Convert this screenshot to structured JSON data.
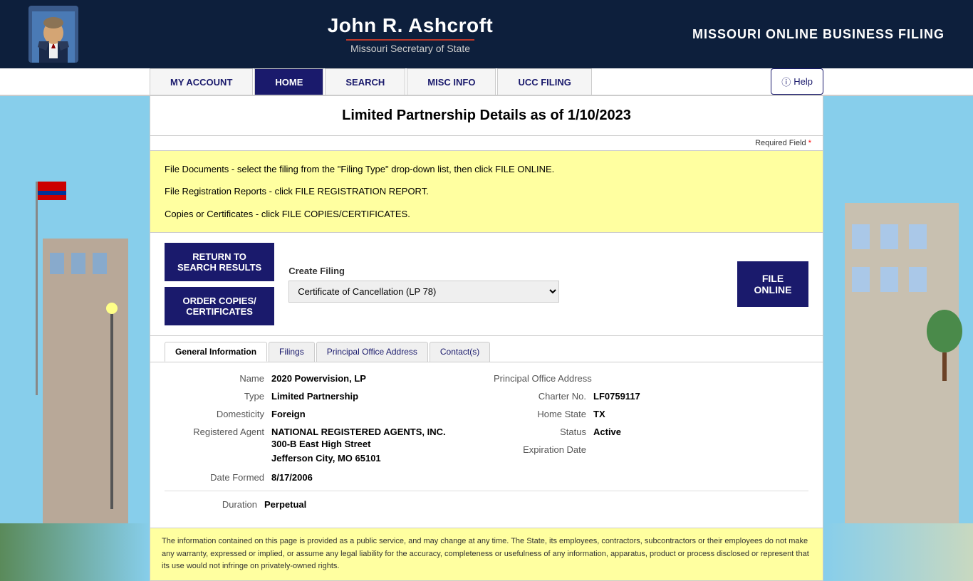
{
  "header": {
    "person_name": "John R. Ashcroft",
    "person_title": "Missouri Secretary of State",
    "site_title": "MISSOURI ONLINE BUSINESS FILING"
  },
  "nav": {
    "items": [
      {
        "label": "MY ACCOUNT",
        "active": false
      },
      {
        "label": "HOME",
        "active": true
      },
      {
        "label": "SEARCH",
        "active": false
      },
      {
        "label": "MISC INFO",
        "active": false
      },
      {
        "label": "UCC FILING",
        "active": false
      }
    ],
    "help_label": "Help"
  },
  "page": {
    "title": "Limited Partnership Details as of 1/10/2023",
    "required_field": "Required Field",
    "instructions": [
      "File Documents - select the filing from the \"Filing Type\" drop-down list, then click FILE ONLINE.",
      "File Registration Reports - click FILE REGISTRATION REPORT.",
      "Copies or Certificates - click FILE COPIES/CERTIFICATES."
    ]
  },
  "actions": {
    "return_to_search": "RETURN TO\nSEARCH RESULTS",
    "order_copies": "ORDER COPIES/\nCERTIFICATES",
    "create_filing_label": "Create Filing",
    "filing_options": [
      "Certificate of Cancellation (LP 78)"
    ],
    "filing_selected": "Certificate of Cancellation (LP 78)",
    "file_online_line1": "FILE",
    "file_online_line2": "ONLINE"
  },
  "tabs": [
    {
      "label": "General Information",
      "active": true
    },
    {
      "label": "Filings",
      "active": false
    },
    {
      "label": "Principal Office Address",
      "active": false
    },
    {
      "label": "Contact(s)",
      "active": false
    }
  ],
  "details": {
    "left": [
      {
        "label": "Name",
        "value": "2020 Powervision, LP",
        "type": "text"
      },
      {
        "label": "Type",
        "value": "Limited Partnership",
        "type": "text"
      },
      {
        "label": "Domesticity",
        "value": "Foreign",
        "type": "text"
      },
      {
        "label": "Registered Agent",
        "value": "NATIONAL REGISTERED AGENTS, INC.",
        "type": "link",
        "address1": "300-B East High Street",
        "address2": "Jefferson City, MO 65101"
      },
      {
        "label": "Date Formed",
        "value": "8/17/2006",
        "type": "text"
      }
    ],
    "right": [
      {
        "label": "Principal Office Address",
        "value": "",
        "type": "text"
      },
      {
        "label": "Charter No.",
        "value": "LF0759117",
        "type": "text"
      },
      {
        "label": "Home State",
        "value": "TX",
        "type": "text"
      },
      {
        "label": "Status",
        "value": "Active",
        "type": "text"
      },
      {
        "label": "Expiration Date",
        "value": "",
        "type": "text"
      }
    ],
    "bottom": [
      {
        "label": "Duration",
        "value": "Perpetual",
        "type": "text"
      }
    ]
  },
  "disclaimer": "The information contained on this page is provided as a public service, and may change at any time. The State, its employees, contractors, subcontractors or their employees do not make any warranty, expressed or implied, or assume any legal liability for the accuracy, completeness or usefulness of any information, apparatus, product or process disclosed or represent that its use would not infringe on privately-owned rights."
}
